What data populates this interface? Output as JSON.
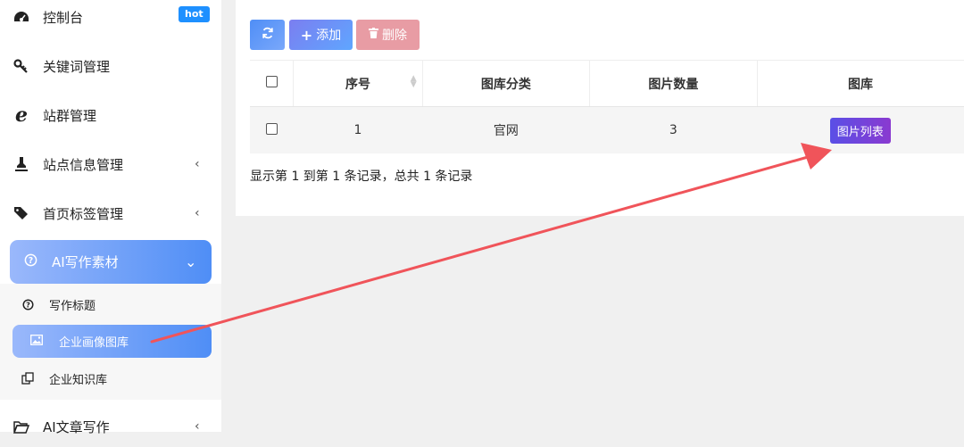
{
  "sidebar": {
    "items": [
      {
        "label": "控制台",
        "icon": "dashboard-icon",
        "badge": "hot"
      },
      {
        "label": "关键词管理",
        "icon": "key-icon"
      },
      {
        "label": "站群管理",
        "icon": "ie-icon"
      },
      {
        "label": "站点信息管理",
        "icon": "stamp-icon",
        "chevron": "‹"
      },
      {
        "label": "首页标签管理",
        "icon": "tags-icon",
        "chevron": "‹"
      }
    ],
    "active_group": {
      "label": "AI写作素材",
      "icon": "question-icon",
      "chevron": "⌄"
    },
    "sub_items": [
      {
        "label": "写作标题",
        "icon": "question-icon"
      },
      {
        "label": "企业画像图库",
        "icon": "image-icon"
      },
      {
        "label": "企业知识库",
        "icon": "copy-icon"
      }
    ],
    "bottom_item": {
      "label": "AI文章写作",
      "icon": "folder-open-icon",
      "chevron": "‹"
    }
  },
  "toolbar": {
    "refresh_icon": "refresh-icon",
    "add_label": "添加",
    "delete_label": "删除"
  },
  "table": {
    "columns": [
      "序号",
      "图库分类",
      "图片数量",
      "图库"
    ],
    "rows": [
      {
        "index": "1",
        "category": "官网",
        "count": "3",
        "action": "图片列表"
      }
    ]
  },
  "summary": "显示第 1 到第 1 条记录，总共 1 条记录",
  "colors": {
    "accent_blue": "#4f8ef6",
    "badge_blue": "#1e90ff",
    "delete_pink": "#e89ca4",
    "list_button_purple": "#6a45dc",
    "annotation_arrow": "#f0545a"
  }
}
